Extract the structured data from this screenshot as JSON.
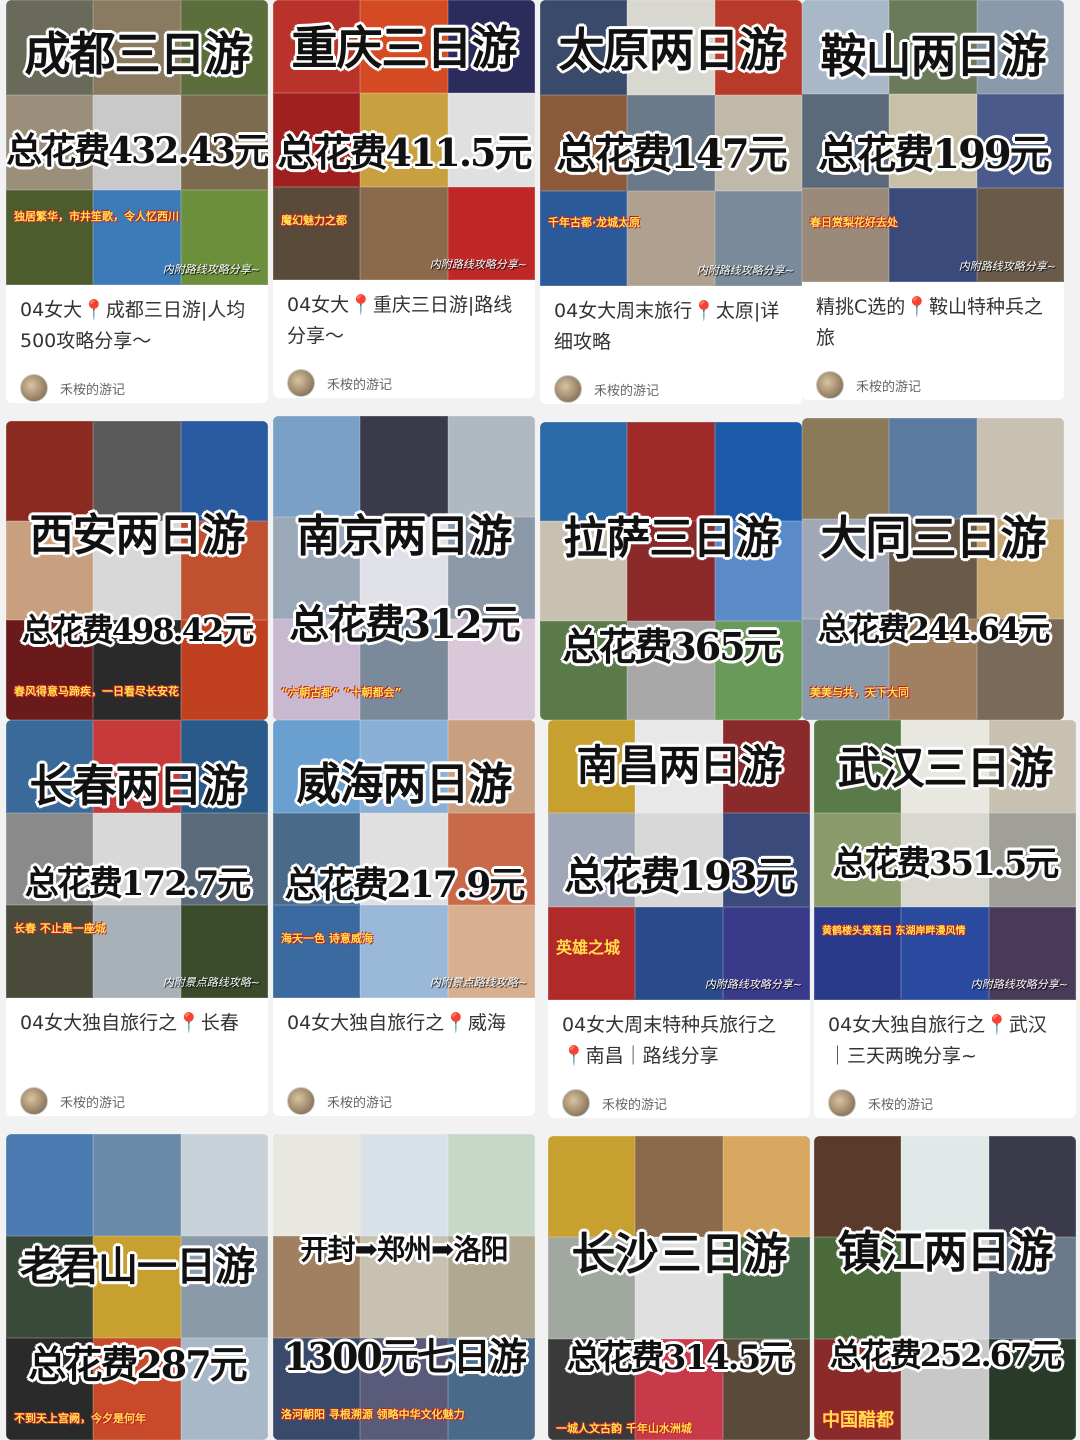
{
  "feed": {
    "cards": [
      {
        "title": "成都三日游",
        "cost": "总花费432.43元",
        "tag": "独居繁华，市井笙歌，令人忆西川",
        "footer": "内附路线攻略分享~",
        "desc_pre": "04女大",
        "desc_post": "成都三日游|人均500攻略分享～",
        "author": "禾桉的游记",
        "colors": [
          "#6a6a5a",
          "#8a7a60",
          "#5b6e3c",
          "#9b8f7b",
          "#c9c9c9",
          "#7d6b4f",
          "#4d5c2f",
          "#3c7bb8",
          "#6b8f3a"
        ]
      },
      {
        "title": "重庆三日游",
        "cost": "总花费411.5元",
        "tag": "魔幻魅力之都",
        "footer": "内附路线攻略分享~",
        "desc_pre": "04女大",
        "desc_post": "重庆三日游|路线分享～",
        "author": "禾桉的游记",
        "colors": [
          "#b9332a",
          "#d44a22",
          "#2b2b5c",
          "#a02020",
          "#c8a040",
          "#e0e0e0",
          "#5a4a3a",
          "#8a6a4a",
          "#c02828"
        ]
      },
      {
        "title": "太原两日游",
        "cost": "总花费147元",
        "tag": "千年古都·龙城太原",
        "footer": "内附路线攻略分享~",
        "desc_pre": "04女大周末旅行",
        "desc_post": "太原|详细攻略",
        "author": "禾桉的游记",
        "colors": [
          "#3a4a6a",
          "#d8d8d0",
          "#b83a2a",
          "#8a5a3a",
          "#6a7a8a",
          "#c0b8a8",
          "#2a5a9a",
          "#b0a090",
          "#7a8a9a"
        ]
      },
      {
        "title": "鞍山两日游",
        "cost": "总花费199元",
        "tag": "春日赏梨花好去处",
        "footer": "内附路线攻略分享~",
        "desc_pre": "精挑C选的",
        "desc_post": "鞍山特种兵之旅",
        "author": "禾桉的游记",
        "colors": [
          "#a8b8c8",
          "#6a7a5a",
          "#8a9aaa",
          "#5a6a7a",
          "#c8c0a8",
          "#4a5a8a",
          "#9a8a7a",
          "#3a4a7a",
          "#6a5a4a"
        ]
      },
      {
        "title": "西安两日游",
        "cost": "总花费498.42元",
        "tag": "春风得意马蹄疾，一日看尽长安花",
        "footer": "",
        "desc_pre": "",
        "desc_post": "",
        "author": "",
        "colors": [
          "#8a2a20",
          "#5a5a5a",
          "#2a5aa0",
          "#c8a080",
          "#d8d8d8",
          "#c05030",
          "#6a1a1a",
          "#2a2a2a",
          "#c04020"
        ]
      },
      {
        "title": "南京两日游",
        "cost": "总花费312元",
        "tag": "“六朝古都” “十朝都会”",
        "footer": "",
        "desc_pre": "",
        "desc_post": "",
        "author": "",
        "colors": [
          "#7aa0c8",
          "#3a3a4a",
          "#b0b8c0",
          "#9aa8b8",
          "#e0e0e8",
          "#8a98a8",
          "#c8b8d0",
          "#7a8a9a",
          "#d8c8d8"
        ]
      },
      {
        "title": "拉萨三日游",
        "cost": "总花费365元",
        "tag": "",
        "footer": "",
        "desc_pre": "",
        "desc_post": "",
        "author": "",
        "colors": [
          "#2a6aa8",
          "#a02a2a",
          "#1a5aa8",
          "#c8c0b0",
          "#8a2a2a",
          "#5a8ac8",
          "#5a7a4a",
          "#a8a8a8",
          "#6a9a5a"
        ]
      },
      {
        "title": "大同三日游",
        "cost": "总花费244.64元",
        "tag": "美美与共，天下大同",
        "footer": "",
        "desc_pre": "",
        "desc_post": "",
        "author": "",
        "colors": [
          "#8a7a5a",
          "#5a7aa0",
          "#c8c0b0",
          "#a0a8b8",
          "#6a5a4a",
          "#c8a870",
          "#8a9aaa",
          "#a08060",
          "#7a6a5a"
        ]
      },
      {
        "title": "长春两日游",
        "cost": "总花费172.7元",
        "tag": "长春 不止是一座城",
        "footer": "内附景点路线攻略~",
        "desc_pre": "04女大独自旅行之",
        "desc_post": "长春",
        "author": "禾桉的游记",
        "colors": [
          "#3a6a9a",
          "#c83a3a",
          "#2a5a8a",
          "#8a8a8a",
          "#d8d8d8",
          "#5a6a7a",
          "#4a4a3a",
          "#a8b0b8",
          "#3a4a2a"
        ]
      },
      {
        "title": "威海两日游",
        "cost": "总花费217.9元",
        "tag": "海天一色 诗意威海",
        "footer": "内附景点路线攻略~",
        "desc_pre": "04女大独自旅行之",
        "desc_post": "威海",
        "author": "禾桉的游记",
        "colors": [
          "#6aa0d0",
          "#8ab0d8",
          "#c8a080",
          "#4a6a8a",
          "#e0e0e0",
          "#c86a4a",
          "#3a6aa0",
          "#9ab8d8",
          "#d8b090"
        ]
      },
      {
        "title": "南昌两日游",
        "cost": "总花费193元",
        "tag": "英雄之城",
        "footer": "内附路线攻略分享~",
        "desc_pre": "04女大周末特种兵旅行之",
        "desc_post": "南昌｜路线分享",
        "author": "禾桉的游记",
        "colors": [
          "#c8a030",
          "#e8e8e8",
          "#8a2a2a",
          "#a0a8b8",
          "#d8d8d8",
          "#3a4a7a",
          "#b02a2a",
          "#2a4a8a",
          "#3a3a8a"
        ]
      },
      {
        "title": "武汉三日游",
        "cost": "总花费351.5元",
        "tag": "黄鹤楼头赏落日 东湖岸畔漫风情",
        "footer": "内附路线攻略分享~",
        "desc_pre": "04女大独自旅行之",
        "desc_post": "武汉｜三天两晚分享~",
        "author": "禾桉的游记",
        "colors": [
          "#5a7a4a",
          "#e8e8e0",
          "#c8c0b0",
          "#8a9a6a",
          "#d8d8d0",
          "#a0a098",
          "#2a3a8a",
          "#2a4aa0",
          "#4a3a5a"
        ]
      },
      {
        "title": "老君山一日游",
        "cost": "总花费287元",
        "tag": "不到天上宫阙，今夕是何年",
        "footer": "",
        "desc_pre": "",
        "desc_post": "",
        "author": "",
        "colors": [
          "#4a7ab0",
          "#6a8aa8",
          "#c8d0d8",
          "#3a4a3a",
          "#c8a030",
          "#8a9aa8",
          "#2a2a2a",
          "#c84a2a",
          "#a8b8c8"
        ]
      },
      {
        "title": "开封➡郑州➡洛阳",
        "cost": "1300元七日游",
        "tag": "洛河朝阳 寻根溯源 领略中华文化魅力",
        "footer": "",
        "desc_pre": "",
        "desc_post": "",
        "author": "",
        "colors": [
          "#e8e8e0",
          "#d8e0e8",
          "#c8d8c8",
          "#a08060",
          "#c8c0b0",
          "#b0a890",
          "#3a4a6a",
          "#5a5a7a",
          "#4a6a8a"
        ]
      },
      {
        "title": "长沙三日游",
        "cost": "总花费314.5元",
        "tag": "一城人文古韵 千年山水洲城",
        "footer": "",
        "desc_pre": "",
        "desc_post": "",
        "author": "",
        "colors": [
          "#c8a030",
          "#8a6a4a",
          "#d8a860",
          "#a0a8a0",
          "#e0e0e0",
          "#4a6a4a",
          "#3a3a3a",
          "#c83a4a",
          "#5a4a3a"
        ]
      },
      {
        "title": "镇江两日游",
        "cost": "总花费252.67元",
        "tag": "中国醋都",
        "footer": "",
        "desc_pre": "",
        "desc_post": "",
        "author": "",
        "colors": [
          "#5a3a2a",
          "#e0e8e8",
          "#3a3a4a",
          "#4a6a3a",
          "#d8d8d8",
          "#6a7a8a",
          "#8a2a2a",
          "#c8c8c8",
          "#2a3a2a"
        ]
      }
    ]
  }
}
